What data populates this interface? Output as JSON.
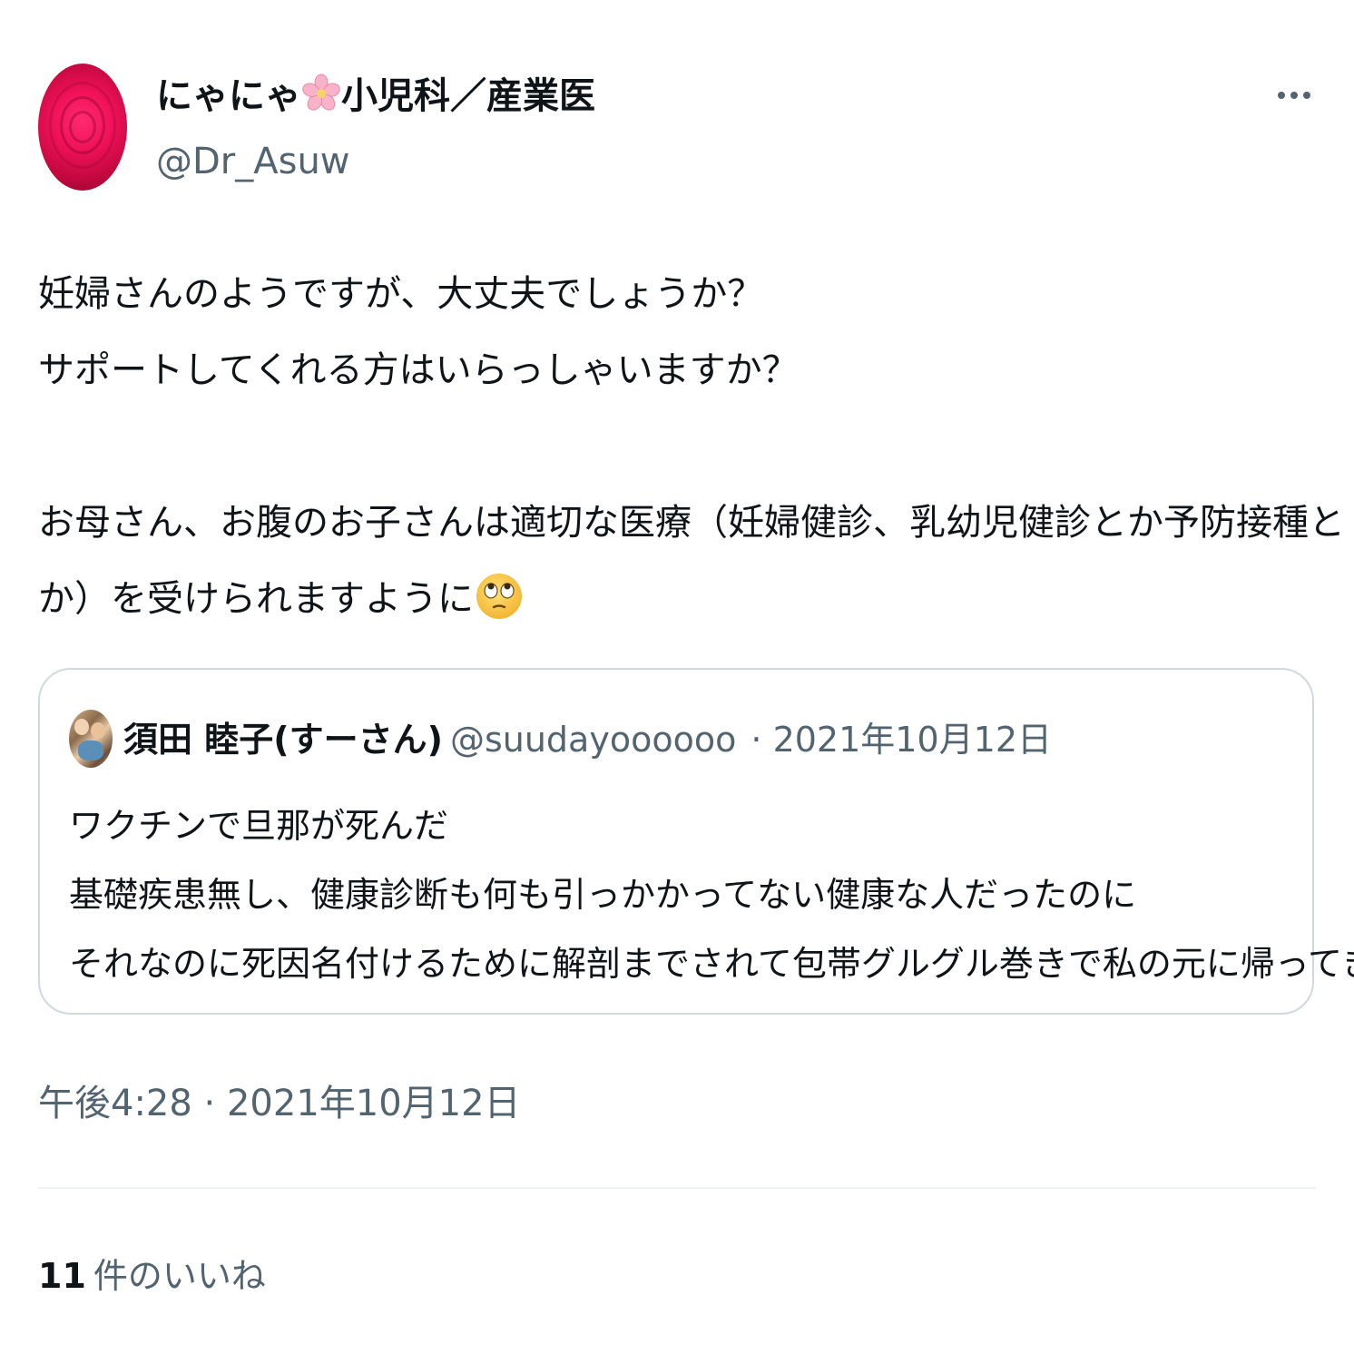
{
  "tweet": {
    "author": {
      "display_name_prefix": "にゃにゃ",
      "display_name_suffix": "小児科／産業医",
      "name_emoji": "cherry-blossom-icon",
      "handle": "@Dr_Asuw",
      "avatar": "rose-avatar"
    },
    "more_icon": "more-horizontal-icon",
    "text_lines": [
      "妊婦さんのようですが、大丈夫でしょうか？",
      "サポートしてくれる方はいらっしゃいますか？",
      "",
      "お母さん、お腹のお子さんは適切な医療（妊婦健診、乳幼児健診とか予防接種と",
      "か）を受けられますように"
    ],
    "trailing_emoji": "face-with-rolling-eyes-icon",
    "timestamp": "午後4:28 · 2021年10月12日",
    "likes_count": "11",
    "likes_label": "件のいいね"
  },
  "quoted_tweet": {
    "author_name": "須田 睦子(すーさん)",
    "author_handle": "@suudayoooooo",
    "date_meta": "· 2021年10月12日",
    "avatar": "family-photo-avatar",
    "text_lines": [
      "ワクチンで旦那が死んだ",
      "基礎疾患無し、健康診断も何も引っかかってない健康な人だったのに",
      "それなのに死因名付けるために解剖までされて包帯グルグル巻きで私の元に帰ってきた"
    ]
  },
  "colors": {
    "text_primary": "#0f1419",
    "text_secondary": "#536471",
    "border": "#cfd9de",
    "divider": "#eff3f4",
    "avatar_rose": "#f0125a"
  }
}
